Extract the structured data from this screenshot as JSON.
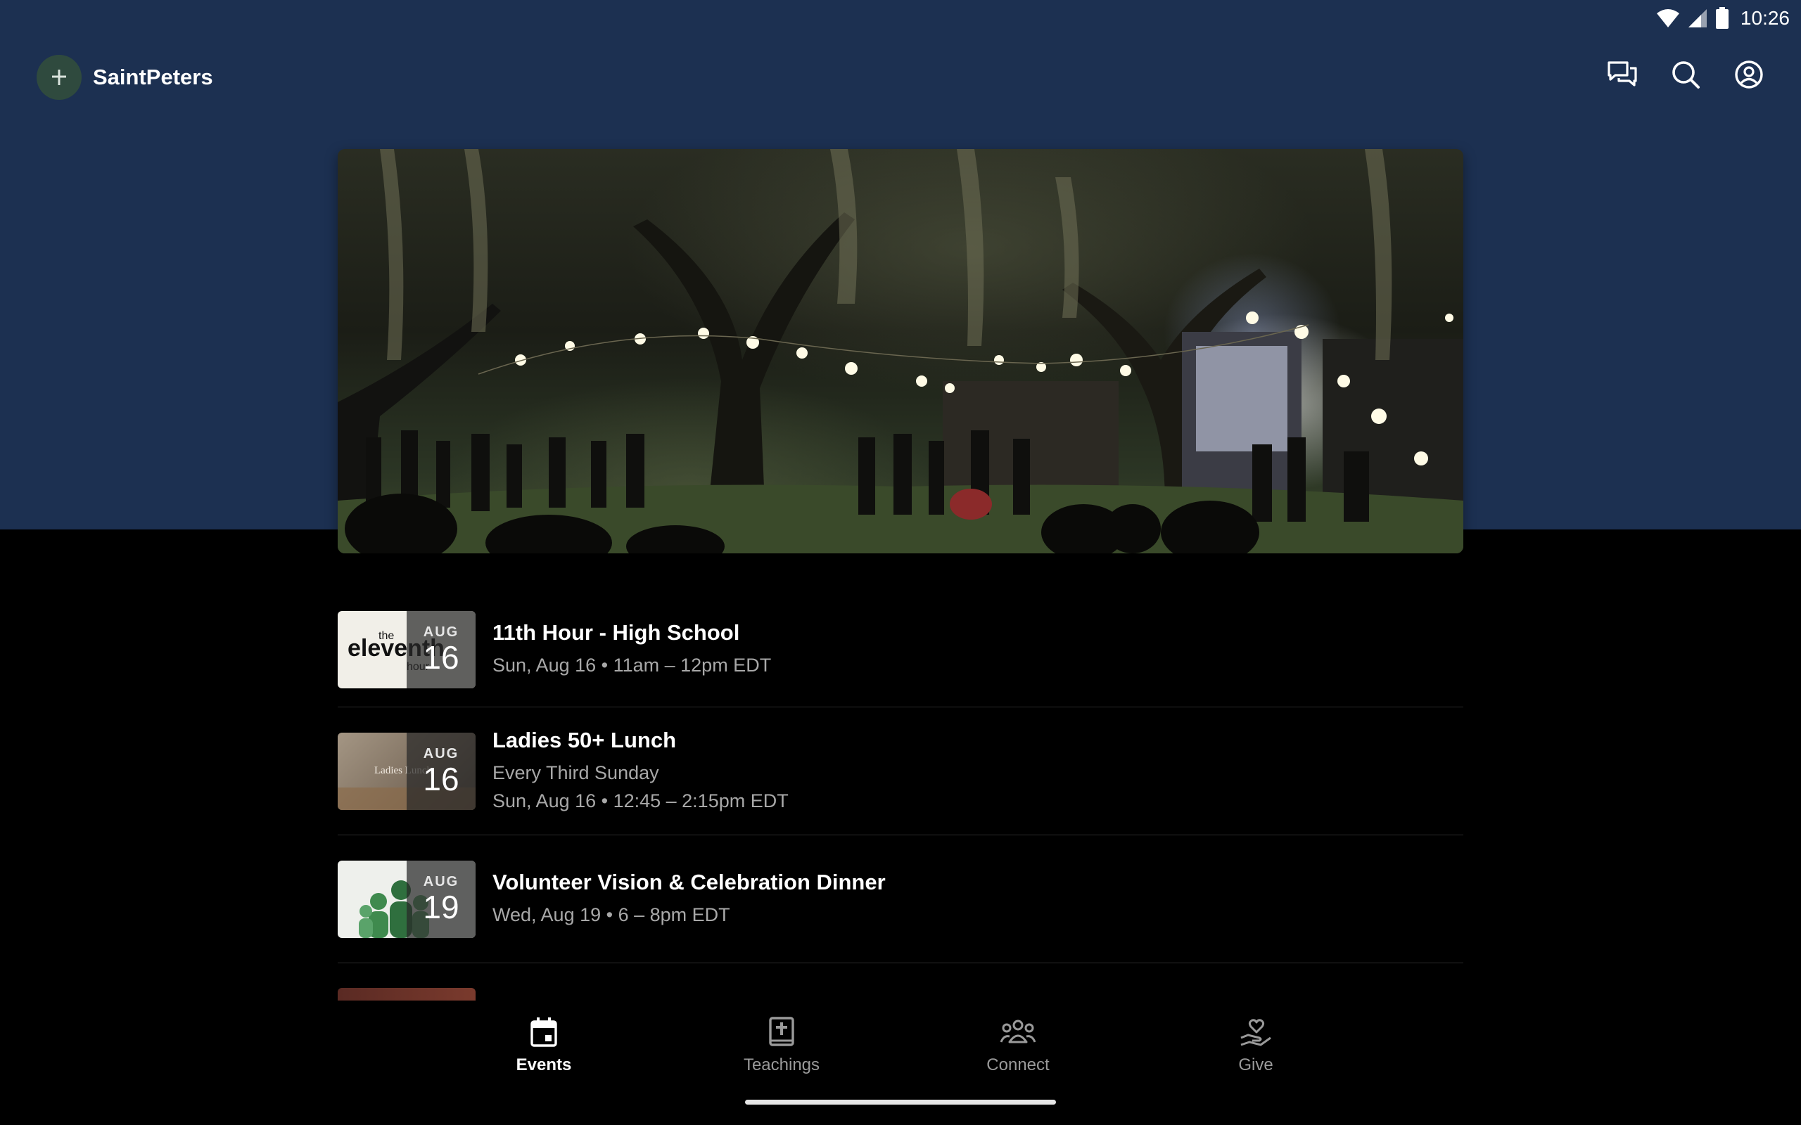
{
  "status_bar": {
    "time": "10:26"
  },
  "app_bar": {
    "brand_name": "SaintPeters",
    "actions": [
      "chat-icon",
      "search-icon",
      "account-icon"
    ]
  },
  "events": [
    {
      "month": "AUG",
      "day": "16",
      "title": "11th Hour - High School",
      "subtitle": "",
      "when": "Sun, Aug 16 • 11am – 12pm EDT",
      "thumb_text_a": "the",
      "thumb_text_b": "eleventh",
      "thumb_text_c": "hour"
    },
    {
      "month": "AUG",
      "day": "16",
      "title": "Ladies 50+ Lunch",
      "subtitle": "Every Third Sunday",
      "when": "Sun, Aug 16 • 12:45 – 2:15pm EDT",
      "thumb_text_a": "Ladies Lunch"
    },
    {
      "month": "AUG",
      "day": "19",
      "title": "Volunteer Vision & Celebration Dinner",
      "subtitle": "",
      "when": "Wed, Aug 19 • 6 – 8pm EDT"
    }
  ],
  "bottom_nav": [
    {
      "label": "Events",
      "icon": "calendar-icon",
      "active": true
    },
    {
      "label": "Teachings",
      "icon": "bible-icon",
      "active": false
    },
    {
      "label": "Connect",
      "icon": "group-icon",
      "active": false
    },
    {
      "label": "Give",
      "icon": "give-icon",
      "active": false
    }
  ],
  "colors": {
    "header_bg": "#1c3051",
    "page_bg": "#000000",
    "muted_text": "#a8a8a8"
  }
}
